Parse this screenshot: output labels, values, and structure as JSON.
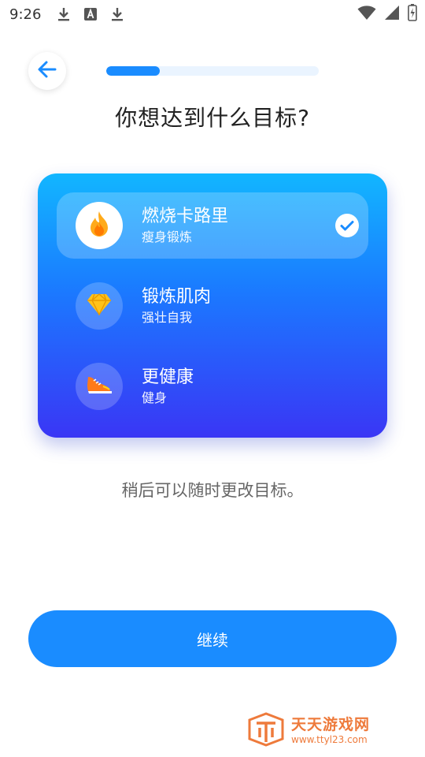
{
  "status_bar": {
    "time": "9:26",
    "icons": [
      "download-icon",
      "font-icon",
      "download-icon",
      "wifi-icon",
      "signal-icon",
      "battery-icon"
    ]
  },
  "header": {
    "back_icon": "arrow-left-icon",
    "progress_fraction": 0.25
  },
  "title": "你想达到什么目标?",
  "goals": [
    {
      "title": "燃烧卡路里",
      "subtitle": "瘦身锻炼",
      "icon": "flame-icon",
      "selected": true
    },
    {
      "title": "锻炼肌肉",
      "subtitle": "强壮自我",
      "icon": "diamond-icon",
      "selected": false
    },
    {
      "title": "更健康",
      "subtitle": "健身",
      "icon": "sneaker-icon",
      "selected": false
    }
  ],
  "hint": "稍后可以随时更改目标。",
  "continue_label": "继续",
  "watermark": {
    "title": "天天游戏网",
    "url": "www.ttyl23.com"
  },
  "colors": {
    "accent": "#1a8cff",
    "card_gradient_top": "#12b6ff",
    "card_gradient_bottom": "#3a36f5",
    "watermark": "#ee7a3b"
  }
}
